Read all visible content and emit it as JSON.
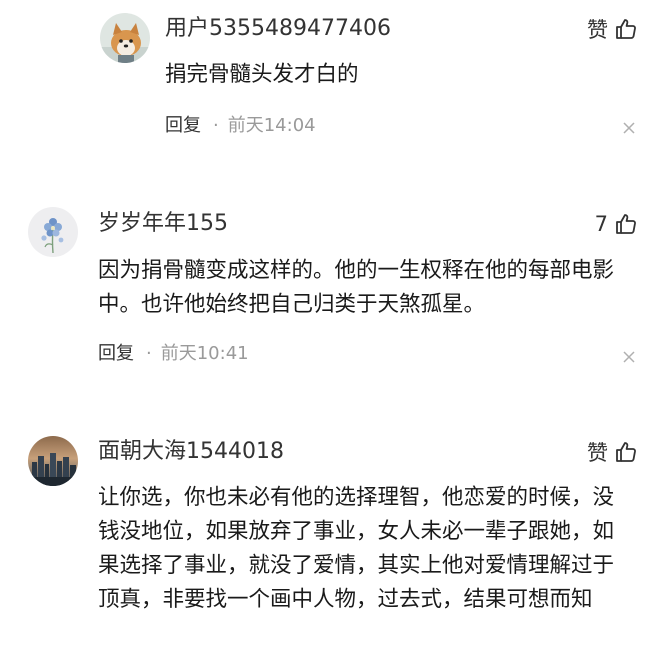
{
  "comments": [
    {
      "username": "用户5355489477406",
      "like_label": "赞",
      "text": "捐完骨髓头发才白的",
      "reply_label": "回复",
      "separator": "·",
      "time": "前天14:04",
      "avatar_icon": "shiba-dog-avatar"
    },
    {
      "username": "岁岁年年155",
      "like_label": "7",
      "text": "因为捐骨髓变成这样的。他的一生权释在他的每部电影中。也许他始终把自己归类于天煞孤星。",
      "reply_label": "回复",
      "separator": "·",
      "time": "前天10:41",
      "avatar_icon": "blue-flower-avatar"
    },
    {
      "username": "面朝大海1544018",
      "like_label": "赞",
      "text": "让你选，你也未必有他的选择理智，他恋爱的时候，没钱没地位，如果放弃了事业，女人未必一辈子跟她，如果选择了事业，就没了爱情，其实上他对爱情理解过于顶真，非要找一个画中人物，过去式，结果可想而知",
      "avatar_icon": "city-skyline-avatar"
    }
  ],
  "colors": {
    "text": "#1a1a1a",
    "secondary": "#9a9a9a",
    "background": "#ffffff"
  }
}
